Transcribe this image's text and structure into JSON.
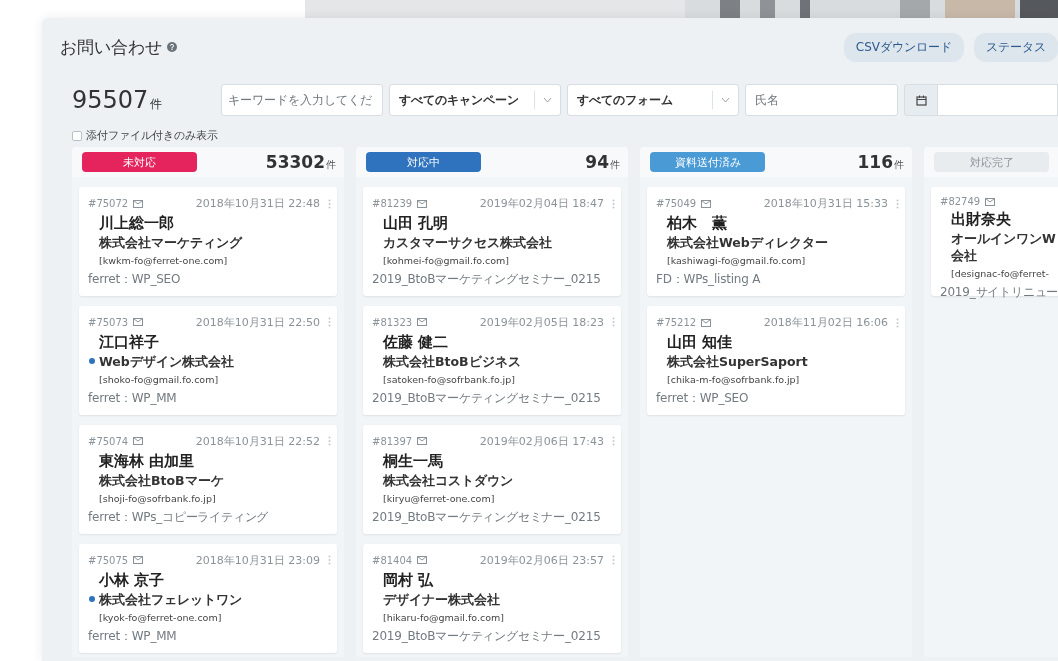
{
  "page": {
    "title": "お問い合わせ",
    "buttons": [
      "CSVダウンロード",
      "ステータス"
    ]
  },
  "total": {
    "value": "95507",
    "unit": "件"
  },
  "filters": [
    {
      "kind": "input",
      "placeholder": "キーワードを入力してくだ"
    },
    {
      "kind": "select",
      "value": "すべてのキャンペーン"
    },
    {
      "kind": "select",
      "value": "すべてのフォーム"
    },
    {
      "kind": "input",
      "placeholder": "氏名"
    },
    {
      "kind": "date"
    }
  ],
  "attachment_filter": {
    "label": "添付ファイル付きのみ表示",
    "checked": false
  },
  "columns": [
    {
      "status": "未対応",
      "color": "#e5245e",
      "count": "53302",
      "unit": "件",
      "cards": [
        {
          "id": "#75072",
          "date": "2018年10月31日 22:48",
          "name": "川上総一郎",
          "company": "株式会社マーケティング",
          "email": "[kwkm-fo@ferret-one.com]",
          "campaign": "ferret：WP_SEO",
          "unread": false
        },
        {
          "id": "#75073",
          "date": "2018年10月31日 22:50",
          "name": "江口祥子",
          "company": "Webデザイン株式会社",
          "email": "[shoko-fo@gmail.fo.com]",
          "campaign": "ferret：WP_MM",
          "unread": true
        },
        {
          "id": "#75074",
          "date": "2018年10月31日 22:52",
          "name": "東海林 由加里",
          "company": "株式会社BtoBマーケ",
          "email": "[shoji-fo@sofrbank.fo.jp]",
          "campaign": "ferret：WPs_コピーライティング",
          "unread": false
        },
        {
          "id": "#75075",
          "date": "2018年10月31日 23:09",
          "name": "小林 京子",
          "company": "株式会社フェレットワン",
          "email": "[kyok-fo@ferret-one.com]",
          "campaign": "ferret：WP_MM",
          "unread": true
        }
      ]
    },
    {
      "status": "対応中",
      "color": "#2f72be",
      "count": "94",
      "unit": "件",
      "cards": [
        {
          "id": "#81239",
          "date": "2019年02月04日 18:47",
          "name": "山田 孔明",
          "company": "カスタマーサクセス株式会社",
          "email": "[kohmei-fo@gmail.fo.com]",
          "campaign": "2019_BtoBマーケティングセミナー_0215",
          "unread": false
        },
        {
          "id": "#81323",
          "date": "2019年02月05日 18:23",
          "name": "佐藤 健二",
          "company": "株式会社BtoBビジネス",
          "email": "[satoken-fo@sofrbank.fo.jp]",
          "campaign": "2019_BtoBマーケティングセミナー_0215",
          "unread": false
        },
        {
          "id": "#81397",
          "date": "2019年02月06日 17:43",
          "name": "桐生一馬",
          "company": "株式会社コストダウン",
          "email": "[kiryu@ferret-one.com]",
          "campaign": "2019_BtoBマーケティングセミナー_0215",
          "unread": false
        },
        {
          "id": "#81404",
          "date": "2019年02月06日 23:57",
          "name": "岡村 弘",
          "company": "デザイナー株式会社",
          "email": "[hikaru-fo@gmail.fo.com]",
          "campaign": "2019_BtoBマーケティングセミナー_0215",
          "unread": false
        }
      ]
    },
    {
      "status": "資料送付済み",
      "color": "#4a9ad6",
      "count": "116",
      "unit": "件",
      "cards": [
        {
          "id": "#75049",
          "date": "2018年10月31日 15:33",
          "name": "柏木　薫",
          "company": "株式会社Webディレクター",
          "email": "[kashiwagi-fo@gmail.fo.com]",
          "campaign": "FD：WPs_listing A",
          "unread": false
        },
        {
          "id": "#75212",
          "date": "2018年11月02日 16:06",
          "name": "山田 知佳",
          "company": "株式会社SuperSaport",
          "email": "[chika-m-fo@sofrbank.fo.jp]",
          "campaign": "ferret：WP_SEO",
          "unread": false
        }
      ]
    },
    {
      "status": "対応完了",
      "color": "#e8ecef",
      "cards": [
        {
          "id": "#82749",
          "name": "出財奈央",
          "company": "オールインワンW\n会社",
          "email": "[designac-fo@ferret-",
          "campaign": "2019_サイトリニュー",
          "unread": false
        }
      ]
    }
  ]
}
